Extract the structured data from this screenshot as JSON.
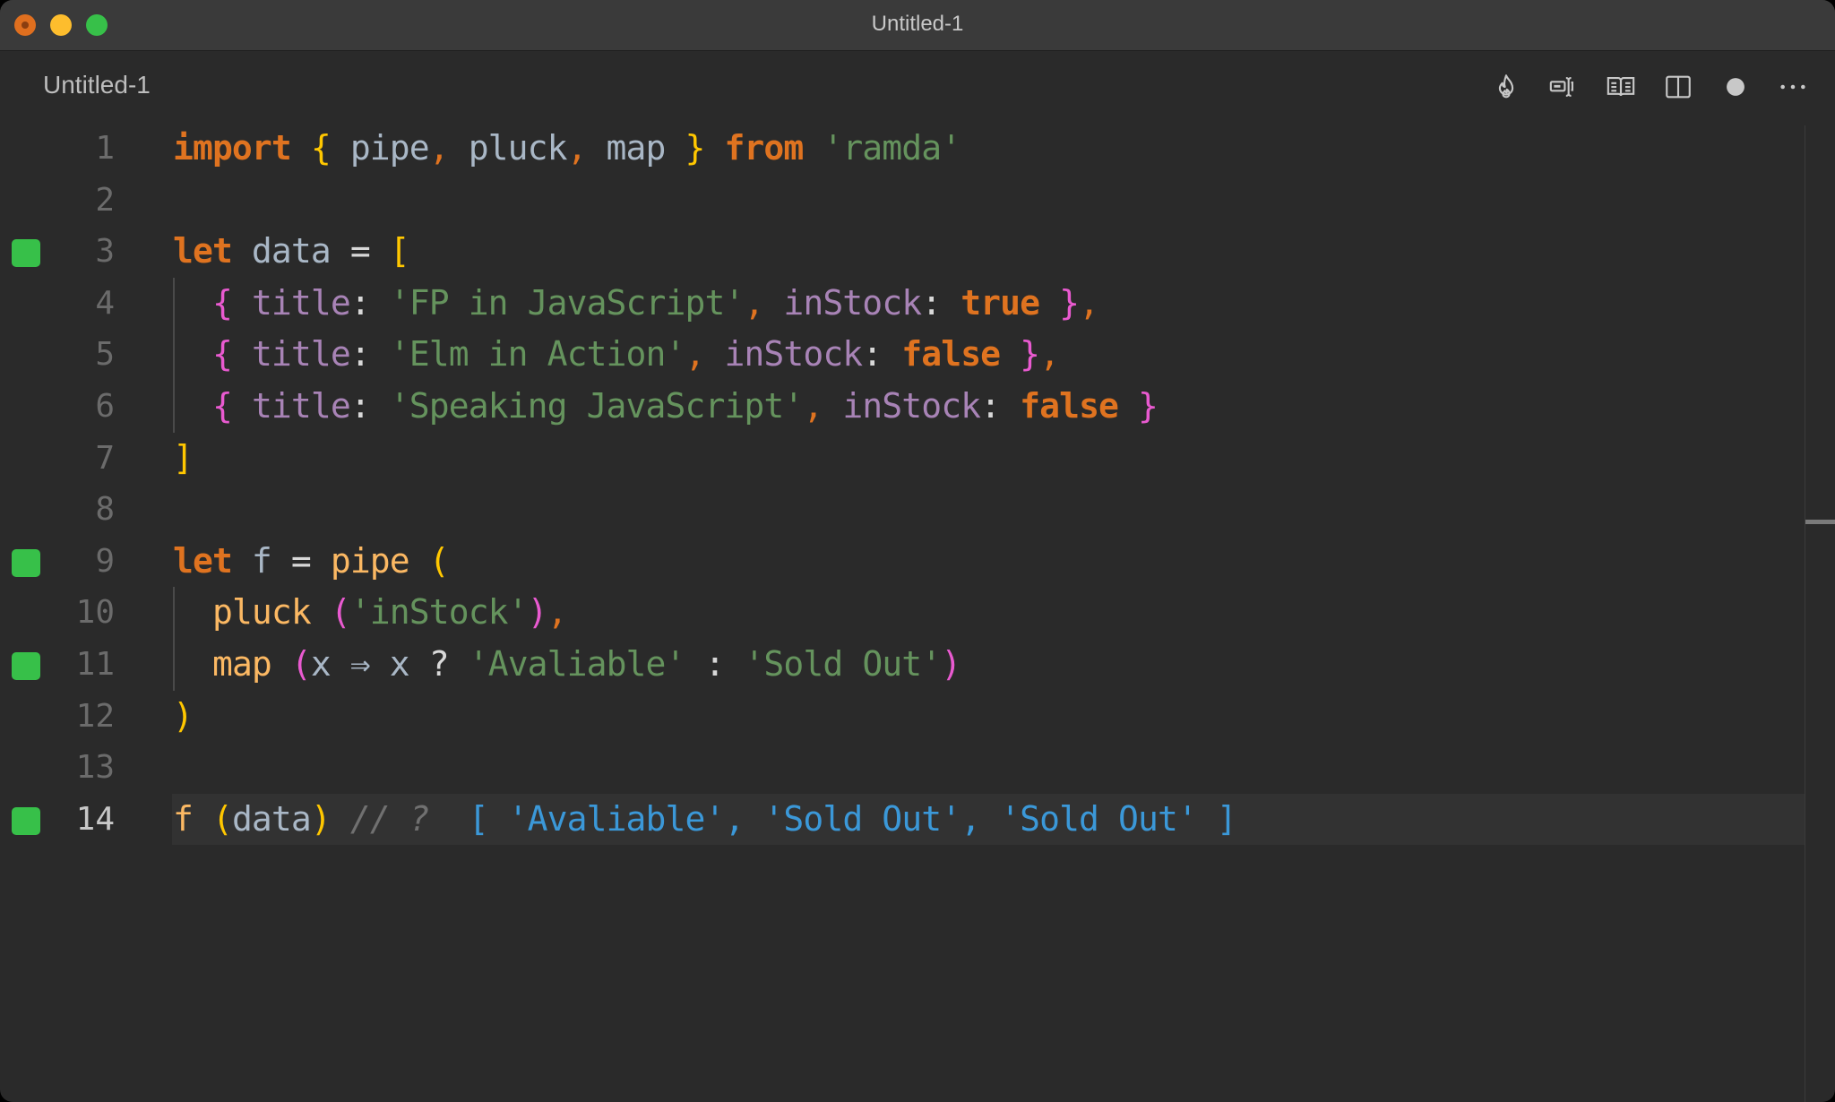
{
  "window": {
    "title": "Untitled-1",
    "controls": [
      "close",
      "minimize",
      "maximize"
    ]
  },
  "tab": {
    "title": "Untitled-1"
  },
  "toolbar": {
    "icons": [
      {
        "name": "flame-icon",
        "label": "Quokka"
      },
      {
        "name": "text-cursor-icon",
        "label": "Live value"
      },
      {
        "name": "book-icon",
        "label": "Open preview"
      },
      {
        "name": "split-editor-icon",
        "label": "Split editor"
      },
      {
        "name": "unsaved-dot-icon",
        "label": "Unsaved changes"
      },
      {
        "name": "more-icon",
        "label": "More actions"
      }
    ]
  },
  "editor": {
    "language": "javascript",
    "active_line": 14,
    "accent_marker_color": "#37c049",
    "lines": [
      {
        "n": "1",
        "marker": false,
        "tokens": [
          [
            "t-kw",
            "import"
          ],
          [
            "t-id",
            " "
          ],
          [
            "t-br1",
            "{"
          ],
          [
            "t-id",
            " pipe"
          ],
          [
            "t-punc",
            ","
          ],
          [
            "t-id",
            " pluck"
          ],
          [
            "t-punc",
            ","
          ],
          [
            "t-id",
            " map "
          ],
          [
            "t-br1",
            "}"
          ],
          [
            "t-id",
            " "
          ],
          [
            "t-kw",
            "from"
          ],
          [
            "t-id",
            " "
          ],
          [
            "t-str",
            "'ramda'"
          ]
        ]
      },
      {
        "n": "2",
        "marker": false,
        "tokens": []
      },
      {
        "n": "3",
        "marker": true,
        "tokens": [
          [
            "t-kw",
            "let"
          ],
          [
            "t-id",
            " data "
          ],
          [
            "t-op",
            "="
          ],
          [
            "t-id",
            " "
          ],
          [
            "t-br1",
            "["
          ]
        ]
      },
      {
        "n": "4",
        "marker": false,
        "tokens": [
          [
            "t-id",
            "  "
          ],
          [
            "t-br2",
            "{"
          ],
          [
            "t-id",
            " "
          ],
          [
            "t-prop",
            "title"
          ],
          [
            "t-op",
            ":"
          ],
          [
            "t-id",
            " "
          ],
          [
            "t-str",
            "'FP in JavaScript'"
          ],
          [
            "t-punc",
            ","
          ],
          [
            "t-id",
            " "
          ],
          [
            "t-prop",
            "inStock"
          ],
          [
            "t-op",
            ":"
          ],
          [
            "t-id",
            " "
          ],
          [
            "t-bool",
            "true"
          ],
          [
            "t-id",
            " "
          ],
          [
            "t-br2",
            "}"
          ],
          [
            "t-punc",
            ","
          ]
        ]
      },
      {
        "n": "5",
        "marker": false,
        "tokens": [
          [
            "t-id",
            "  "
          ],
          [
            "t-br2",
            "{"
          ],
          [
            "t-id",
            " "
          ],
          [
            "t-prop",
            "title"
          ],
          [
            "t-op",
            ":"
          ],
          [
            "t-id",
            " "
          ],
          [
            "t-str",
            "'Elm in Action'"
          ],
          [
            "t-punc",
            ","
          ],
          [
            "t-id",
            " "
          ],
          [
            "t-prop",
            "inStock"
          ],
          [
            "t-op",
            ":"
          ],
          [
            "t-id",
            " "
          ],
          [
            "t-bool",
            "false"
          ],
          [
            "t-id",
            " "
          ],
          [
            "t-br2",
            "}"
          ],
          [
            "t-punc",
            ","
          ]
        ]
      },
      {
        "n": "6",
        "marker": false,
        "tokens": [
          [
            "t-id",
            "  "
          ],
          [
            "t-br2",
            "{"
          ],
          [
            "t-id",
            " "
          ],
          [
            "t-prop",
            "title"
          ],
          [
            "t-op",
            ":"
          ],
          [
            "t-id",
            " "
          ],
          [
            "t-str",
            "'Speaking JavaScript'"
          ],
          [
            "t-punc",
            ","
          ],
          [
            "t-id",
            " "
          ],
          [
            "t-prop",
            "inStock"
          ],
          [
            "t-op",
            ":"
          ],
          [
            "t-id",
            " "
          ],
          [
            "t-bool",
            "false"
          ],
          [
            "t-id",
            " "
          ],
          [
            "t-br2",
            "}"
          ]
        ]
      },
      {
        "n": "7",
        "marker": false,
        "tokens": [
          [
            "t-br1",
            "]"
          ]
        ]
      },
      {
        "n": "8",
        "marker": false,
        "tokens": []
      },
      {
        "n": "9",
        "marker": true,
        "tokens": [
          [
            "t-kw",
            "let"
          ],
          [
            "t-id",
            " f "
          ],
          [
            "t-op",
            "="
          ],
          [
            "t-id",
            " "
          ],
          [
            "t-fn",
            "pipe"
          ],
          [
            "t-id",
            " "
          ],
          [
            "t-br1",
            "("
          ]
        ]
      },
      {
        "n": "10",
        "marker": false,
        "tokens": [
          [
            "t-id",
            "  "
          ],
          [
            "t-fn",
            "pluck"
          ],
          [
            "t-id",
            " "
          ],
          [
            "t-br2",
            "("
          ],
          [
            "t-str",
            "'inStock'"
          ],
          [
            "t-br2",
            ")"
          ],
          [
            "t-punc",
            ","
          ]
        ]
      },
      {
        "n": "11",
        "marker": true,
        "tokens": [
          [
            "t-id",
            "  "
          ],
          [
            "t-fn",
            "map"
          ],
          [
            "t-id",
            " "
          ],
          [
            "t-br2",
            "("
          ],
          [
            "t-id",
            "x "
          ],
          [
            "t-id",
            "⇒"
          ],
          [
            "t-id",
            " x "
          ],
          [
            "t-op",
            "?"
          ],
          [
            "t-id",
            " "
          ],
          [
            "t-str",
            "'Avaliable'"
          ],
          [
            "t-id",
            " "
          ],
          [
            "t-op",
            ":"
          ],
          [
            "t-id",
            " "
          ],
          [
            "t-str",
            "'Sold Out'"
          ],
          [
            "t-br2",
            ")"
          ]
        ]
      },
      {
        "n": "12",
        "marker": false,
        "tokens": [
          [
            "t-br1",
            ")"
          ]
        ]
      },
      {
        "n": "13",
        "marker": false,
        "tokens": []
      },
      {
        "n": "14",
        "marker": true,
        "tokens": [
          [
            "t-fn",
            "f"
          ],
          [
            "t-id",
            " "
          ],
          [
            "t-br1",
            "("
          ],
          [
            "t-id",
            "data"
          ],
          [
            "t-br1",
            ")"
          ],
          [
            "t-id",
            " "
          ],
          [
            "t-com",
            "// ?"
          ],
          [
            "t-id",
            "  "
          ],
          [
            "t-res",
            "[ 'Avaliable', 'Sold Out', 'Sold Out' ]"
          ]
        ]
      }
    ]
  }
}
